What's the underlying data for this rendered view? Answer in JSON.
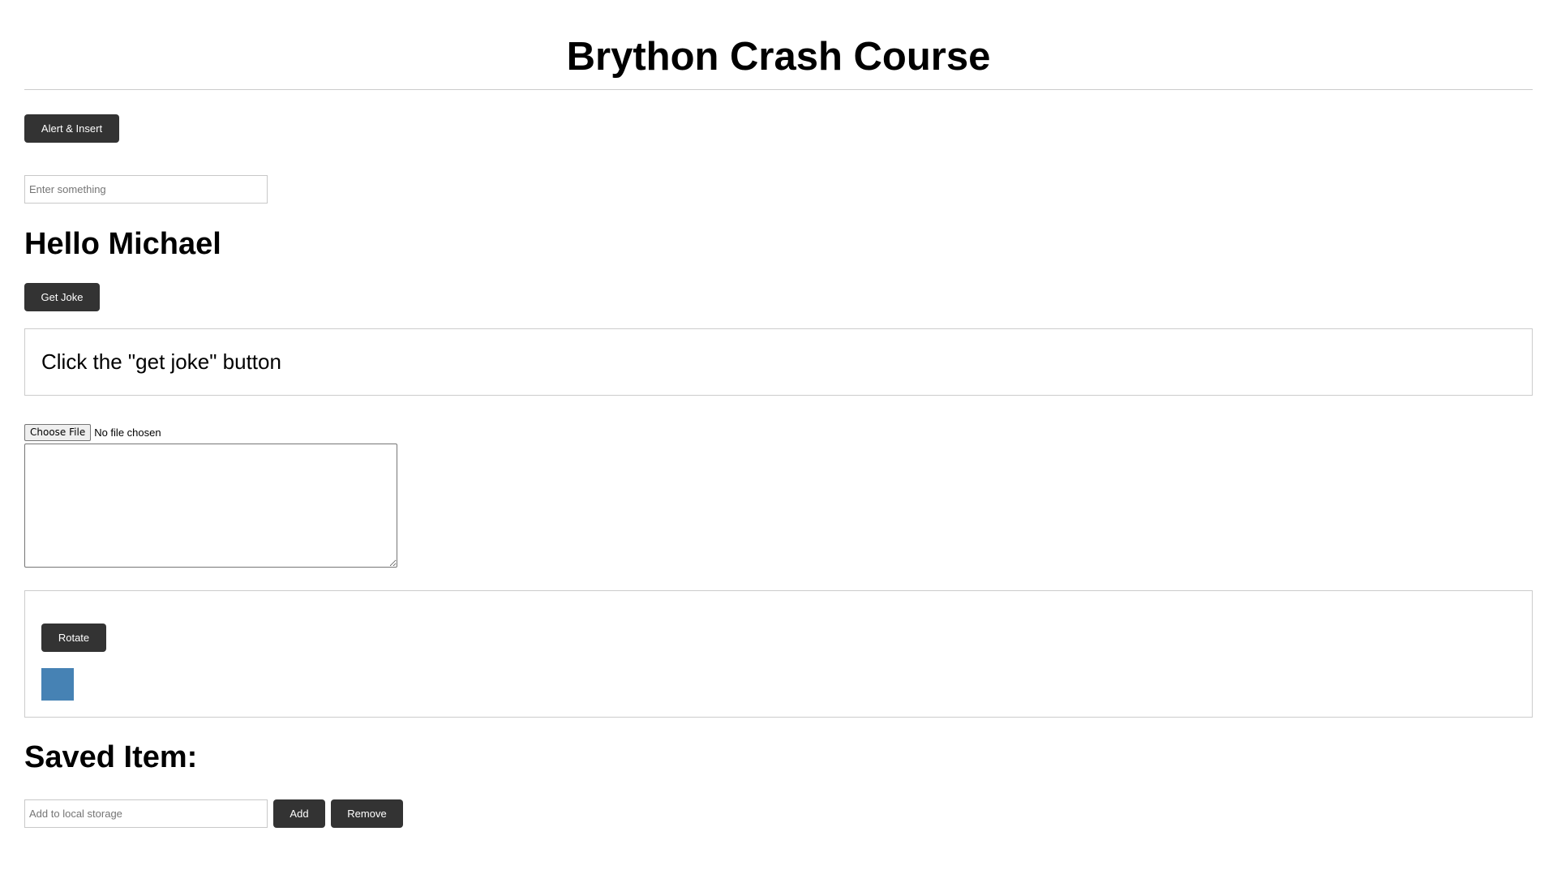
{
  "header": {
    "title": "Brython Crash Course"
  },
  "alert_section": {
    "button_label": "Alert & Insert"
  },
  "name_input": {
    "placeholder": "Enter something",
    "value": ""
  },
  "greeting": {
    "text": "Hello Michael"
  },
  "joke": {
    "button_label": "Get Joke",
    "display_text": "Click the \"get joke\" button"
  },
  "file_section": {
    "choose_label": "Choose File",
    "status_text": "No file chosen",
    "textarea_value": ""
  },
  "rotate_section": {
    "button_label": "Rotate",
    "square_color": "#4682b4"
  },
  "storage": {
    "heading": "Saved Item:",
    "input_placeholder": "Add to local storage",
    "add_label": "Add",
    "remove_label": "Remove"
  },
  "colors": {
    "button_bg": "#333333",
    "button_text": "#ffffff",
    "border": "#cccccc"
  }
}
